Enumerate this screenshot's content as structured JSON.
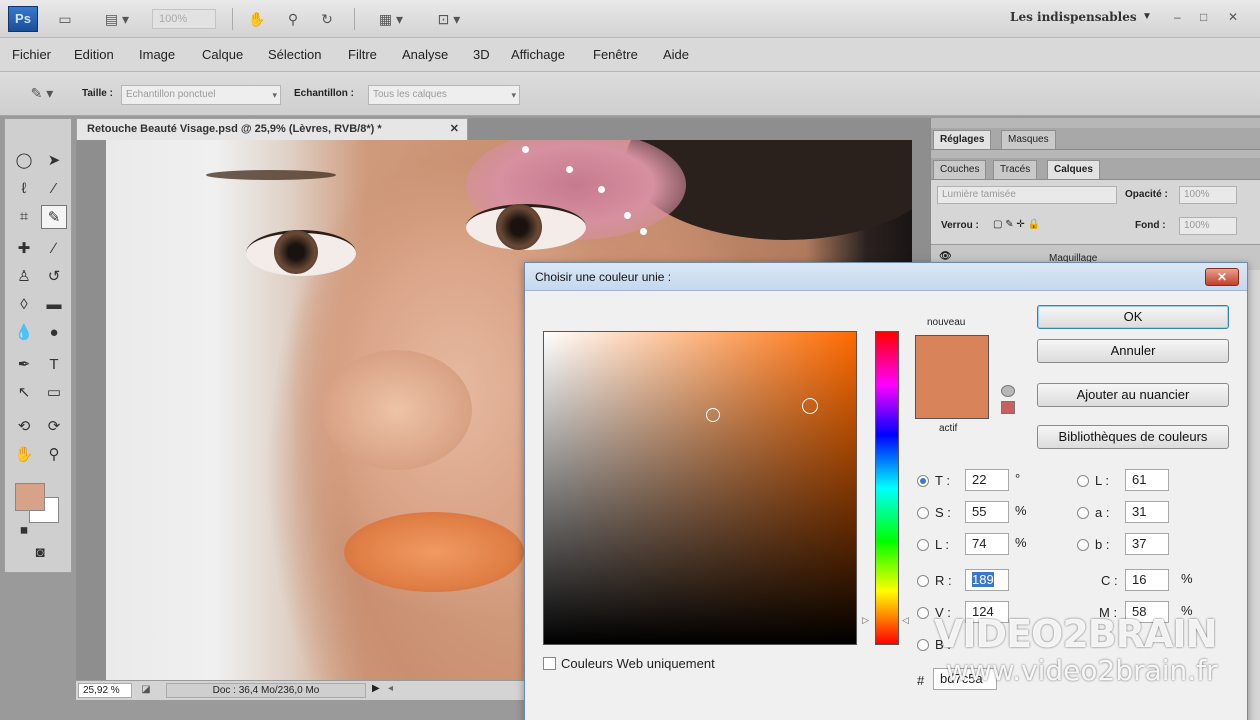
{
  "app": {
    "logo": "Ps",
    "zoom_placeholder": "100%",
    "workspace": "Les indispensables",
    "window_controls": [
      "–",
      "□",
      "✕"
    ]
  },
  "menu": [
    "Fichier",
    "Edition",
    "Image",
    "Calque",
    "Sélection",
    "Filtre",
    "Analyse",
    "3D",
    "Affichage",
    "Fenêtre",
    "Aide"
  ],
  "options": {
    "size_label": "Taille :",
    "size_value": "Echantillon ponctuel",
    "sample_label": "Echantillon :",
    "sample_value": "Tous les calques"
  },
  "document": {
    "tab_title": "Retouche Beauté Visage.psd @ 25,9% (Lèvres, RVB/8*) *",
    "zoom": "25,92 %",
    "doc_info": "Doc : 36,4 Mo/236,0 Mo"
  },
  "panels": {
    "top_tabs": [
      "Réglages",
      "Masques"
    ],
    "layer_tabs": [
      "Couches",
      "Tracés",
      "Calques"
    ],
    "blend_mode": "Lumière tamisée",
    "opacity_label": "Opacité :",
    "opacity_value": "100%",
    "lock_label": "Verrou :",
    "fill_label": "Fond :",
    "fill_value": "100%",
    "layer_name": "Maquillage"
  },
  "dialog": {
    "title": "Choisir une couleur unie :",
    "close": "✕",
    "new_label": "nouveau",
    "current_label": "actif",
    "new_color": "#d8835a",
    "buttons": {
      "ok": "OK",
      "cancel": "Annuler",
      "add_swatch": "Ajouter au nuancier",
      "libraries": "Bibliothèques de couleurs"
    },
    "fields": {
      "H": {
        "label": "T :",
        "value": "22",
        "unit": "°"
      },
      "S": {
        "label": "S :",
        "value": "55",
        "unit": "%"
      },
      "Bv": {
        "label": "L :",
        "value": "74",
        "unit": "%"
      },
      "R": {
        "label": "R :",
        "value": "189"
      },
      "G": {
        "label": "V :",
        "value": "124"
      },
      "B": {
        "label": "B :"
      },
      "Lab_L": {
        "label": "L :",
        "value": "61"
      },
      "Lab_a": {
        "label": "a :",
        "value": "31"
      },
      "Lab_b": {
        "label": "b :",
        "value": "37"
      },
      "C": {
        "label": "C :",
        "value": "16",
        "unit": "%"
      },
      "M": {
        "label": "M :",
        "value": "58",
        "unit": "%"
      },
      "hex": {
        "label": "#",
        "value": "bd7c5a"
      }
    },
    "web_only_label": "Couleurs Web uniquement"
  },
  "watermark": {
    "brand": "VIDEO2BRAIN",
    "url": "www.video2brain.fr"
  },
  "colors": {
    "foreground": "#d8a288",
    "background": "#ffffff",
    "hue": "#ff6a00"
  }
}
